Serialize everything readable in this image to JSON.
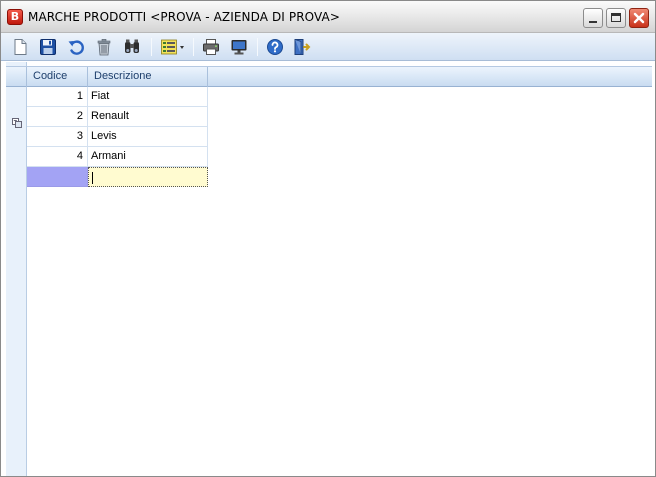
{
  "window": {
    "title": "MARCHE PRODOTTI <PROVA - AZIENDA DI PROVA>",
    "app_icon_letter": "B",
    "controls": [
      "minimize",
      "maximize",
      "close"
    ]
  },
  "toolbar": {
    "buttons": [
      {
        "name": "new",
        "icon": "new-document-icon"
      },
      {
        "name": "save",
        "icon": "floppy-disk-icon"
      },
      {
        "name": "undo",
        "icon": "undo-arrow-icon"
      },
      {
        "name": "delete",
        "icon": "trash-can-icon"
      },
      {
        "name": "search",
        "icon": "binoculars-icon"
      },
      {
        "name": "view-options",
        "icon": "list-view-dropdown-icon"
      },
      {
        "name": "print",
        "icon": "printer-icon"
      },
      {
        "name": "preview",
        "icon": "monitor-icon"
      },
      {
        "name": "help",
        "icon": "help-icon"
      },
      {
        "name": "exit",
        "icon": "exit-door-icon"
      }
    ]
  },
  "grid": {
    "columns": [
      "Codice",
      "Descrizione"
    ],
    "rows": [
      {
        "codice": "1",
        "descrizione": "Fiat"
      },
      {
        "codice": "2",
        "descrizione": "Renault"
      },
      {
        "codice": "3",
        "descrizione": "Levis"
      },
      {
        "codice": "4",
        "descrizione": "Armani"
      }
    ],
    "new_row": {
      "codice": "",
      "descrizione": ""
    }
  },
  "colors": {
    "header_text": "#1e3f6c",
    "new_row_code_bg": "#a3a3f4",
    "new_row_edit_bg": "#fffbd0",
    "close_button": "#c8321a"
  }
}
